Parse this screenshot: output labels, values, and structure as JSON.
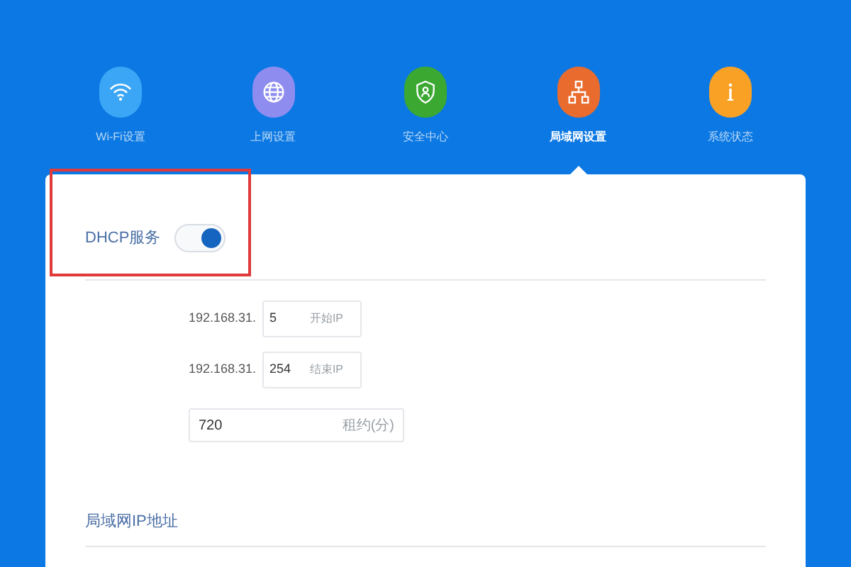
{
  "nav": [
    {
      "label": "Wi-Fi设置",
      "color": "#3aa6f5",
      "selected": false
    },
    {
      "label": "上网设置",
      "color": "#8f8cf0",
      "selected": false
    },
    {
      "label": "安全中心",
      "color": "#3aa831",
      "selected": false
    },
    {
      "label": "局域网设置",
      "color": "#e96b2e",
      "selected": true
    },
    {
      "label": "系统状态",
      "color": "#f9a125",
      "selected": false
    }
  ],
  "dhcp": {
    "label": "DHCP服务",
    "on": true
  },
  "range": [
    {
      "prefix": "192.168.31.",
      "value": "5",
      "hint": "开始IP"
    },
    {
      "prefix": "192.168.31.",
      "value": "254",
      "hint": "结束IP"
    }
  ],
  "lease": {
    "value": "720",
    "hint": "租约(分)"
  },
  "lan_section": {
    "title": "局域网IP地址"
  }
}
